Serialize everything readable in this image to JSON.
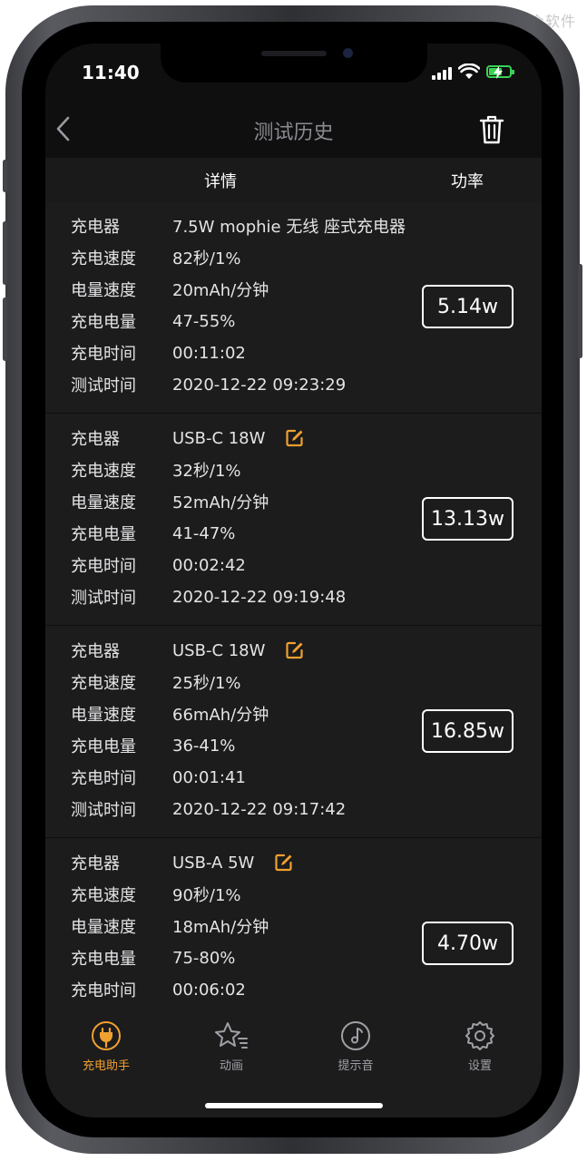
{
  "watermark": "小众软件",
  "status_bar": {
    "time": "11:40"
  },
  "nav": {
    "title": "测试历史"
  },
  "columns": {
    "details": "详情",
    "power": "功率"
  },
  "labels": {
    "charger": "充电器",
    "charge_speed": "充电速度",
    "capacity_speed": "电量速度",
    "charge_amount": "充电电量",
    "charge_time": "充电时间",
    "test_time": "测试时间"
  },
  "records": [
    {
      "charger": "7.5W mophie 无线 座式充电器",
      "editable": false,
      "charge_speed": "82秒/1%",
      "capacity_speed": "20mAh/分钟",
      "charge_amount": "47-55%",
      "charge_time": "00:11:02",
      "test_time": "2020-12-22 09:23:29",
      "power": "5.14w"
    },
    {
      "charger": "USB-C 18W",
      "editable": true,
      "charge_speed": "32秒/1%",
      "capacity_speed": "52mAh/分钟",
      "charge_amount": "41-47%",
      "charge_time": "00:02:42",
      "test_time": "2020-12-22 09:19:48",
      "power": "13.13w"
    },
    {
      "charger": "USB-C 18W",
      "editable": true,
      "charge_speed": "25秒/1%",
      "capacity_speed": "66mAh/分钟",
      "charge_amount": "36-41%",
      "charge_time": "00:01:41",
      "test_time": "2020-12-22 09:17:42",
      "power": "16.85w"
    },
    {
      "charger": "USB-A 5W",
      "editable": true,
      "charge_speed": "90秒/1%",
      "capacity_speed": "18mAh/分钟",
      "charge_amount": "75-80%",
      "charge_time": "00:06:02",
      "test_time": "",
      "power": "4.70w"
    }
  ],
  "tabs": [
    {
      "label": "充电助手",
      "icon": "charging-plug-icon",
      "active": true
    },
    {
      "label": "动画",
      "icon": "star-list-icon",
      "active": false
    },
    {
      "label": "提示音",
      "icon": "music-disc-icon",
      "active": false
    },
    {
      "label": "设置",
      "icon": "gear-icon",
      "active": false
    }
  ],
  "colors": {
    "accent": "#f0a030",
    "background": "#0f0f10",
    "card": "#1c1c1d",
    "battery": "#39d353"
  }
}
